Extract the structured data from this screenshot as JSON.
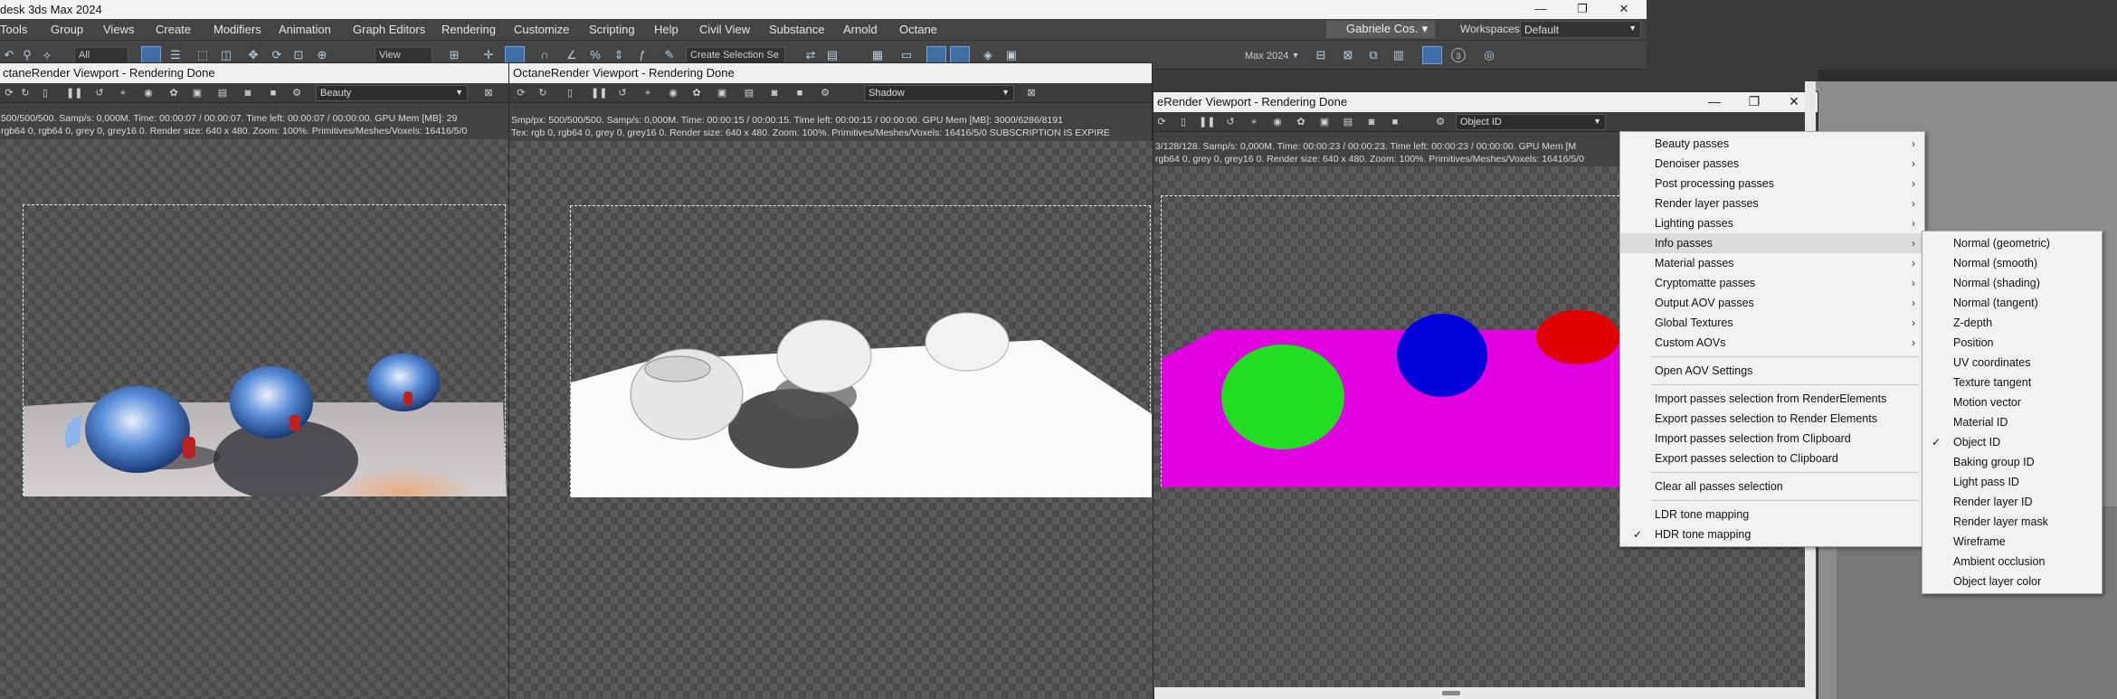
{
  "app": {
    "title": "desk 3ds Max 2024",
    "window_buttons": [
      "—",
      "❐",
      "✕"
    ]
  },
  "menu": {
    "items": [
      "Tools",
      "Group",
      "Views",
      "Create",
      "Modifiers",
      "Animation",
      "Graph Editors",
      "Rendering",
      "Customize",
      "Scripting",
      "Help",
      "Civil View",
      "Substance",
      "Arnold",
      "Octane"
    ],
    "user": "Gabriele Cos...",
    "workspaces_label": "Workspaces:",
    "workspace_value": "Default"
  },
  "toolbar": {
    "filter_value": "All",
    "view_value": "View",
    "selection_set": "Create Selection Se",
    "partial_title": "Max 2024",
    "counter": "3"
  },
  "viewports": [
    {
      "title": "ctaneRender Viewport - Rendering Done",
      "pass": "Beauty",
      "stats_line1": "500/500/500.  Samp/s: 0,000M.  Time: 00:00:07 / 00:00:07.  Time left: 00:00:07 / 00:00:00.  GPU Mem [MB]: 29",
      "stats_line2": "rgb64 0, rgb64 0, grey 0, grey16 0.  Render size: 640 x 480.  Zoom: 100%.  Primitives/Meshes/Voxels: 16416/5/0"
    },
    {
      "title": "OctaneRender Viewport - Rendering Done",
      "pass": "Shadow",
      "stats_line1": "Smp/px: 500/500/500.  Samp/s: 0,000M.  Time: 00:00:15 / 00:00:15.  Time left: 00:00:15 / 00:00:00.  GPU Mem [MB]: 3000/6286/8191",
      "stats_line2": "Tex: rgb 0, rgb64 0, grey 0, grey16 0.  Render size: 640 x 480.  Zoom: 100%.  Primitives/Meshes/Voxels: 16416/5/0   SUBSCRIPTION IS EXPIRE"
    },
    {
      "title": "eRender Viewport - Rendering Done",
      "pass": "Object ID",
      "stats_line1": "3/128/128.  Samp/s: 0,000M.  Time: 00:00:23 / 00:00:23.  Time left: 00:00:23 / 00:00:00.  GPU Mem [M",
      "stats_line2": "rgb64 0, grey 0, grey16 0.  Render size: 640 x 480.  Zoom: 100%.  Primitives/Meshes/Voxels: 16416/5/0"
    }
  ],
  "passes_menu": {
    "groups": [
      {
        "label": "Beauty passes",
        "submenu": true
      },
      {
        "label": "Denoiser passes",
        "submenu": true
      },
      {
        "label": "Post processing passes",
        "submenu": true
      },
      {
        "label": "Render layer passes",
        "submenu": true
      },
      {
        "label": "Lighting passes",
        "submenu": true
      },
      {
        "label": "Info passes",
        "submenu": true,
        "highlighted": true
      },
      {
        "label": "Material passes",
        "submenu": true
      },
      {
        "label": "Cryptomatte passes",
        "submenu": true
      },
      {
        "label": "Output AOV passes",
        "submenu": true
      },
      {
        "label": "Global Textures",
        "submenu": true
      },
      {
        "label": "Custom AOVs",
        "submenu": true
      }
    ],
    "open_aov": "Open AOV Settings",
    "io_items": [
      "Import passes selection from RenderElements",
      "Export passes selection to Render Elements",
      "Import passes selection from Clipboard",
      "Export passes selection to Clipboard"
    ],
    "clear": "Clear all passes selection",
    "tone_mapping": [
      {
        "label": "LDR tone mapping",
        "checked": false
      },
      {
        "label": "HDR tone mapping",
        "checked": true
      }
    ],
    "arrow": "›",
    "check": "✓"
  },
  "info_submenu": {
    "items": [
      {
        "label": "Normal (geometric)",
        "checked": false
      },
      {
        "label": "Normal (smooth)",
        "checked": false
      },
      {
        "label": "Normal (shading)",
        "checked": false
      },
      {
        "label": "Normal (tangent)",
        "checked": false
      },
      {
        "label": "Z-depth",
        "checked": false
      },
      {
        "label": "Position",
        "checked": false
      },
      {
        "label": "UV coordinates",
        "checked": false
      },
      {
        "label": "Texture tangent",
        "checked": false
      },
      {
        "label": "Motion vector",
        "checked": false
      },
      {
        "label": "Material ID",
        "checked": false
      },
      {
        "label": "Object ID",
        "checked": true
      },
      {
        "label": "Baking group ID",
        "checked": false
      },
      {
        "label": "Light pass ID",
        "checked": false
      },
      {
        "label": "Render layer ID",
        "checked": false
      },
      {
        "label": "Render layer mask",
        "checked": false
      },
      {
        "label": "Wireframe",
        "checked": false
      },
      {
        "label": "Ambient occlusion",
        "checked": false
      },
      {
        "label": "Object layer color",
        "checked": false
      }
    ]
  },
  "colors": {
    "object_id_bg": "#e000e0",
    "object_id_green": "#22dd22",
    "object_id_blue": "#0000d8",
    "object_id_red": "#e00000"
  }
}
